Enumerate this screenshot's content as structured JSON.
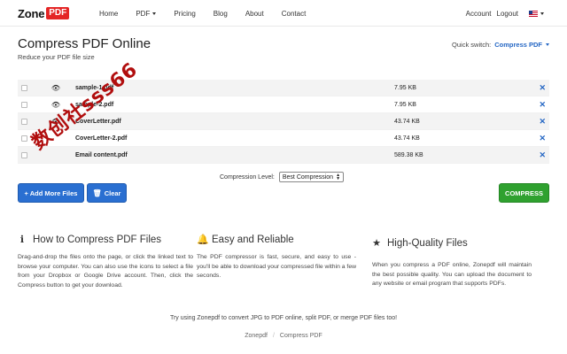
{
  "nav": {
    "logo_word": "Zone",
    "logo_badge": "PDF",
    "links": [
      "Home",
      "PDF",
      "Pricing",
      "Blog",
      "About",
      "Contact"
    ],
    "account": "Account",
    "logout": "Logout"
  },
  "header": {
    "title": "Compress PDF Online",
    "subtitle": "Reduce your PDF file size",
    "quick_switch_label": "Quick switch:",
    "quick_switch_value": "Compress PDF"
  },
  "files": [
    {
      "name": "sample-1.pdf",
      "size": "7.95 KB"
    },
    {
      "name": "sample-2.pdf",
      "size": "7.95 KB"
    },
    {
      "name": "CoverLetter.pdf",
      "size": "43.74 KB"
    },
    {
      "name": "CoverLetter-2.pdf",
      "size": "43.74 KB"
    },
    {
      "name": "Email content.pdf",
      "size": "589.38 KB"
    }
  ],
  "compression": {
    "label": "Compression Level:",
    "value": "Best Compression"
  },
  "buttons": {
    "add": "+ Add More Files",
    "clear": "Clear",
    "compress": "COMPRESS"
  },
  "features": [
    {
      "title": "How to Compress PDF Files",
      "icon": "info-icon",
      "text": "Drag-and-drop the files onto the page, or click the linked text to browse your computer. You can also use the icons to select a file from your Dropbox or Google Drive account. Then, click the Compress button to get your download."
    },
    {
      "title": "Easy and Reliable",
      "icon": "bell-icon",
      "text": "The PDF compressor is fast, secure, and easy to use - you'll be able to download your compressed file within a few seconds."
    },
    {
      "title": "High-Quality Files",
      "icon": "star-icon",
      "text": "When you compress a PDF online, Zonepdf will maintain the best possible quality. You can upload the document to any website or email program that supports PDFs."
    }
  ],
  "footer": {
    "try_text": "Try using Zonepdf to convert JPG to PDF online, split PDF, or merge PDF files too!",
    "crumb_home": "Zonepdf",
    "crumb_current": "Compress PDF"
  },
  "watermark": "数创社sss66"
}
